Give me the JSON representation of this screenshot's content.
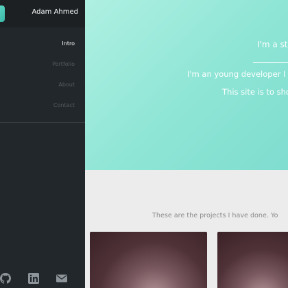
{
  "sidebar": {
    "name": "Adam Ahmed",
    "nav": [
      {
        "label": "Intro"
      },
      {
        "label": "Portfolio"
      },
      {
        "label": "About"
      },
      {
        "label": "Contact"
      }
    ],
    "social": [
      {
        "icon": "github-icon"
      },
      {
        "icon": "linkedin-icon"
      },
      {
        "icon": "mail-icon"
      }
    ]
  },
  "hero": {
    "title": "I'm a st",
    "text1": "I'm an young developer l",
    "text2": "This site is to sho"
  },
  "projects": {
    "intro": "These are the projects I have done. Yo"
  },
  "colors": {
    "sidebar_bg": "#22272b",
    "accent": "#8ee5d5",
    "nav_active": "#ffffff",
    "nav_inactive": "#535b60"
  }
}
